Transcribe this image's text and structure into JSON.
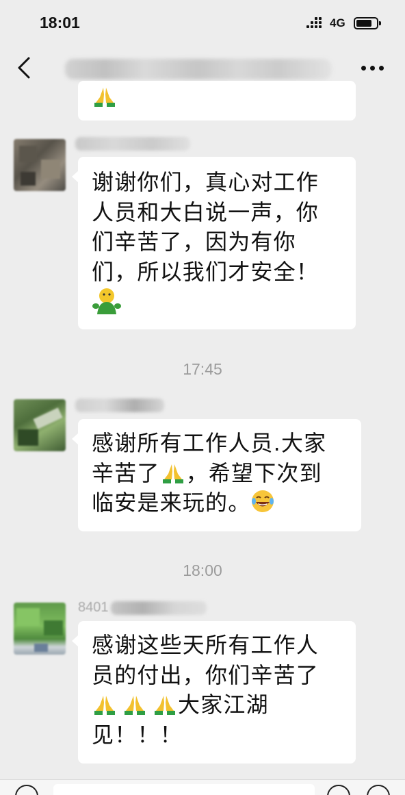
{
  "status_bar": {
    "time": "18:01",
    "network": "4G"
  },
  "nav": {
    "back_icon": "chevron-left-icon",
    "more_icon": "more-dots-icon"
  },
  "messages": [
    {
      "id": "msg-0",
      "emoji": "folded-hands-emoji"
    },
    {
      "id": "msg-1",
      "lines": [
        "谢谢你们，真心对工作",
        "人员和大白说一声，你",
        "们辛苦了，因为有你",
        "们，所以我们才安全！"
      ],
      "emoji": "green-blob-emoji"
    },
    {
      "id": "msg-2",
      "lines": [
        "感谢所有工作人员.大家",
        "辛苦了",
        "，希望下次到",
        "临安是来玩的。"
      ],
      "emoji": [
        "folded-hands-emoji",
        "laughing-tears-emoji"
      ]
    },
    {
      "id": "msg-3",
      "lines": [
        "感谢这些天所有工作人",
        "员的付出，你们辛苦了",
        "大家江湖",
        "见！！！"
      ],
      "emoji": "folded-hands-emoji"
    }
  ],
  "timestamps": [
    "17:45",
    "18:00"
  ],
  "sender_partial": "8401"
}
